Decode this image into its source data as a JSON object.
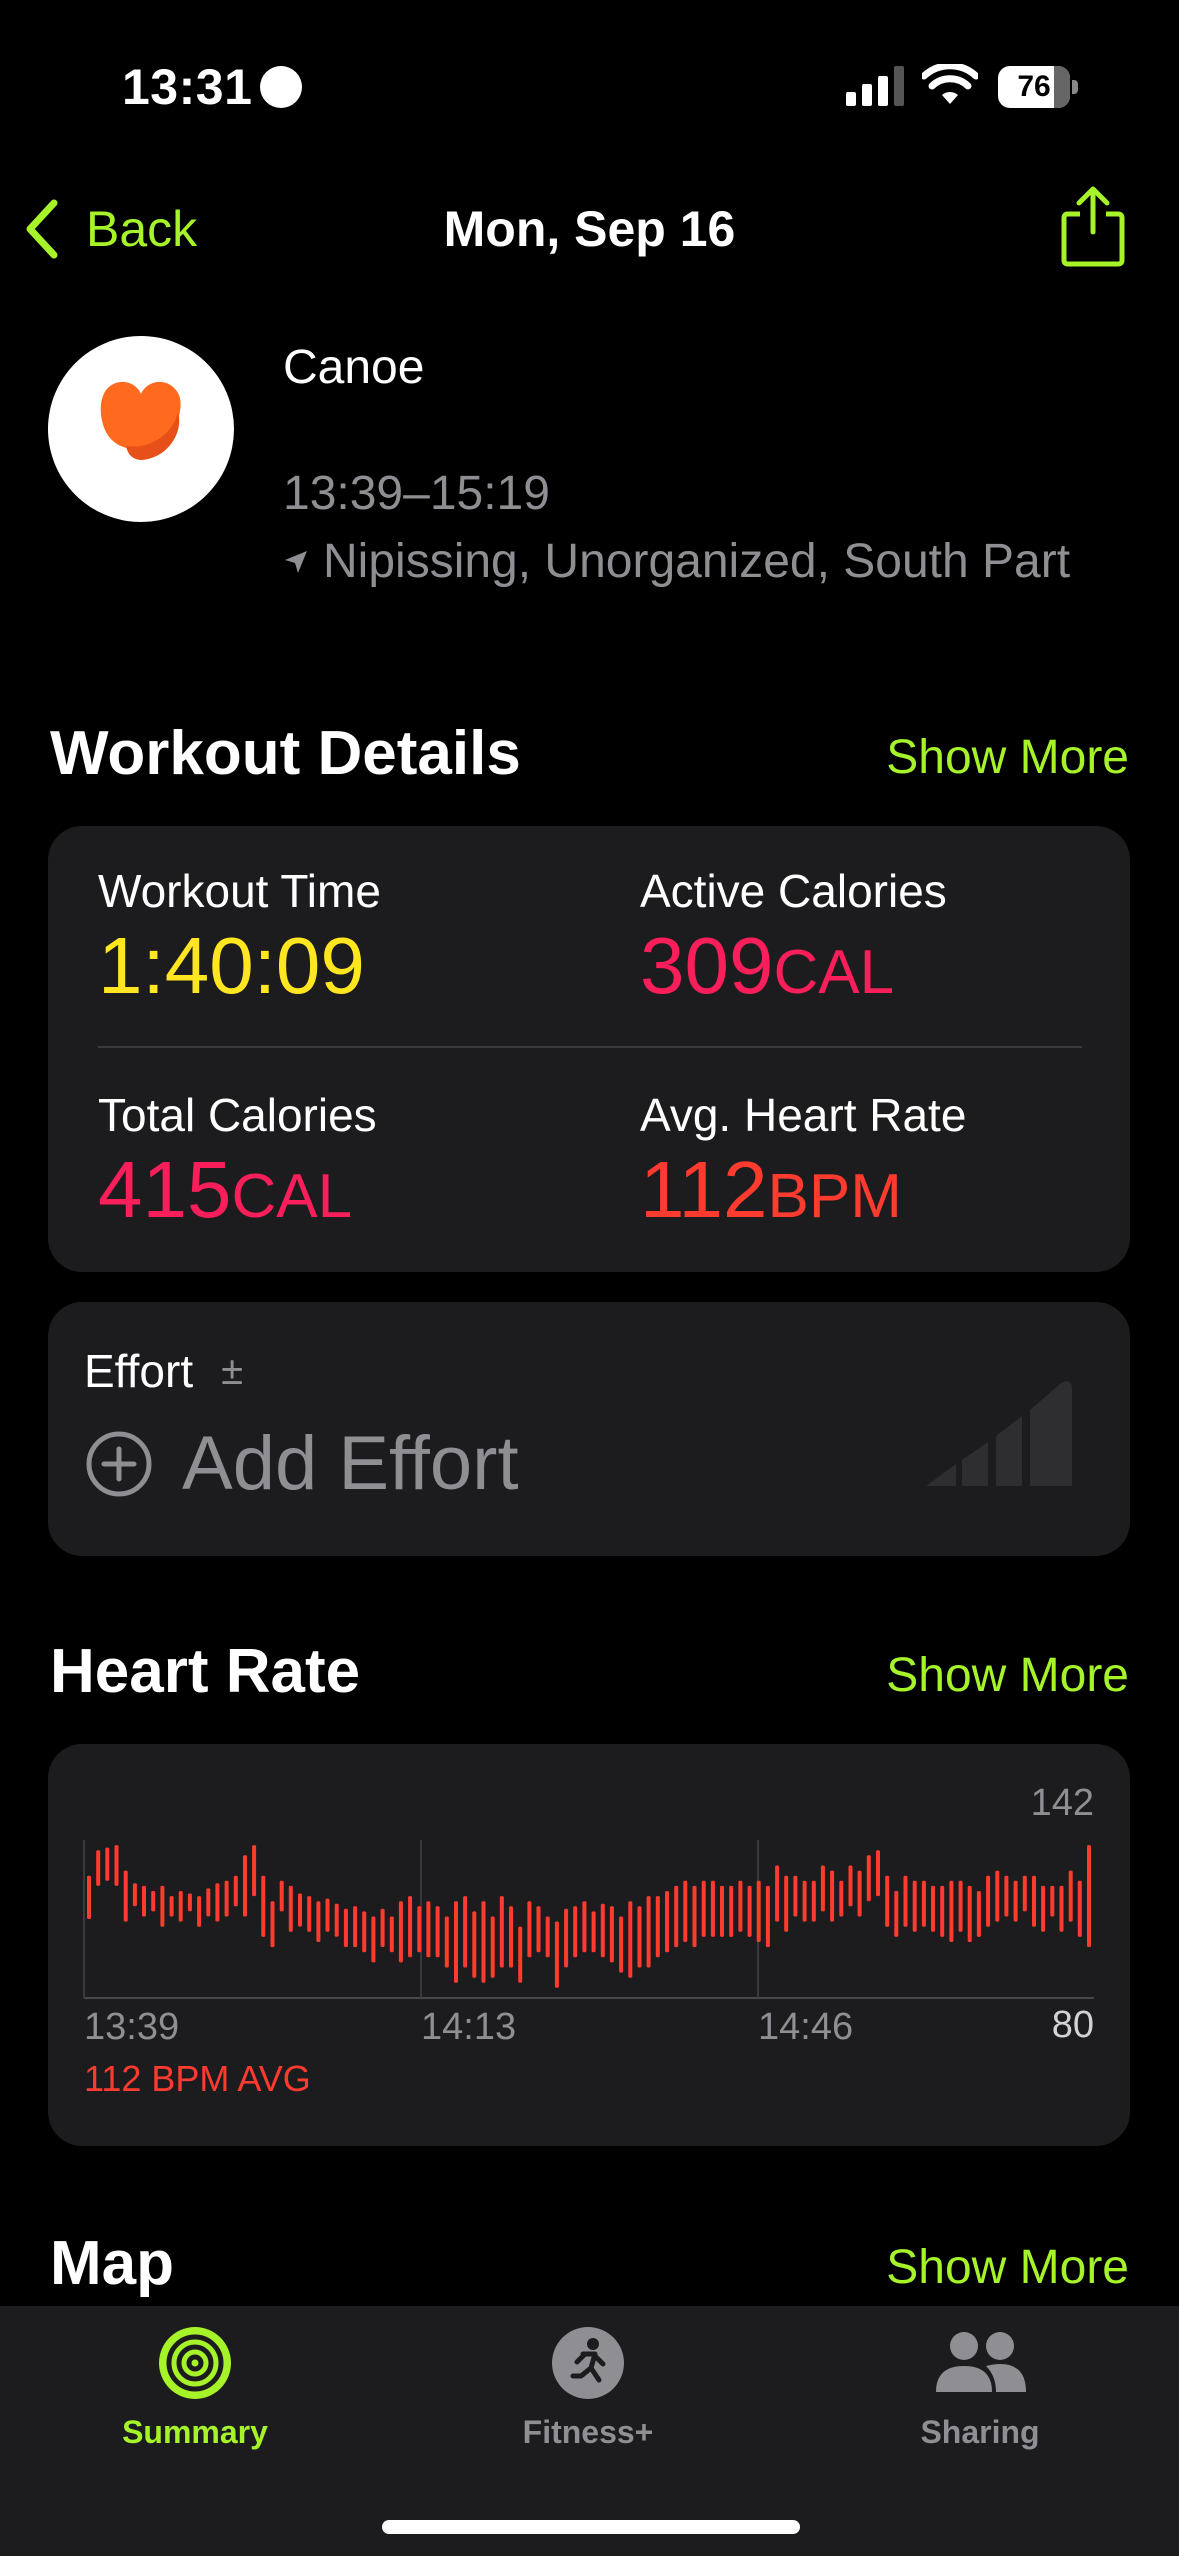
{
  "status_bar": {
    "time": "13:31",
    "battery": "76"
  },
  "nav": {
    "back_label": "Back",
    "title": "Mon, Sep 16"
  },
  "activity": {
    "name": "Canoe",
    "time_range": "13:39–15:19",
    "location": "Nipissing, Unorganized, South Part"
  },
  "workout_details": {
    "title": "Workout Details",
    "show_more": "Show More",
    "stats": [
      {
        "label": "Workout Time",
        "value": "1:40:09",
        "unit": "",
        "color": "#ffe620"
      },
      {
        "label": "Active Calories",
        "value": "309",
        "unit": "CAL",
        "color": "#fa1e5a"
      },
      {
        "label": "Total Calories",
        "value": "415",
        "unit": "CAL",
        "color": "#fa1e5a"
      },
      {
        "label": "Avg. Heart Rate",
        "value": "112",
        "unit": "BPM",
        "color": "#ff3b30"
      }
    ]
  },
  "effort": {
    "label": "Effort",
    "adjust_symbol": "±",
    "add_label": "Add Effort"
  },
  "heart_rate": {
    "title": "Heart Rate",
    "show_more": "Show More",
    "avg_label": "112 BPM AVG",
    "ymax_label": "142",
    "ymin_label": "80",
    "x_labels": [
      "13:39",
      "14:13",
      "14:46"
    ]
  },
  "chart_data": {
    "type": "bar",
    "title": "",
    "xlabel": "",
    "ylabel": "",
    "ylim": [
      80,
      142
    ],
    "x_ticks": [
      "13:39",
      "14:13",
      "14:46"
    ],
    "series": [
      {
        "values": [
          [
            111,
            128
          ],
          [
            124,
            138
          ],
          [
            126,
            139
          ],
          [
            124,
            140
          ],
          [
            110,
            130
          ],
          [
            116,
            125
          ],
          [
            112,
            124
          ],
          [
            114,
            122
          ],
          [
            108,
            124
          ],
          [
            112,
            120
          ],
          [
            110,
            122
          ],
          [
            114,
            121
          ],
          [
            108,
            120
          ],
          [
            112,
            123
          ],
          [
            110,
            125
          ],
          [
            112,
            126
          ],
          [
            116,
            128
          ],
          [
            112,
            136
          ],
          [
            120,
            140
          ],
          [
            104,
            128
          ],
          [
            100,
            118
          ],
          [
            114,
            126
          ],
          [
            106,
            124
          ],
          [
            108,
            121
          ],
          [
            106,
            120
          ],
          [
            102,
            118
          ],
          [
            106,
            119
          ],
          [
            104,
            117
          ],
          [
            100,
            115
          ],
          [
            100,
            116
          ],
          [
            98,
            114
          ],
          [
            94,
            112
          ],
          [
            100,
            115
          ],
          [
            98,
            112
          ],
          [
            94,
            118
          ],
          [
            96,
            120
          ],
          [
            98,
            116
          ],
          [
            96,
            118
          ],
          [
            96,
            116
          ],
          [
            92,
            112
          ],
          [
            86,
            118
          ],
          [
            92,
            120
          ],
          [
            88,
            114
          ],
          [
            86,
            118
          ],
          [
            88,
            112
          ],
          [
            92,
            120
          ],
          [
            92,
            116
          ],
          [
            86,
            108
          ],
          [
            96,
            118
          ],
          [
            98,
            116
          ],
          [
            96,
            112
          ],
          [
            84,
            110
          ],
          [
            92,
            115
          ],
          [
            96,
            116
          ],
          [
            98,
            118
          ],
          [
            98,
            114
          ],
          [
            96,
            117
          ],
          [
            94,
            116
          ],
          [
            90,
            112
          ],
          [
            88,
            118
          ],
          [
            92,
            116
          ],
          [
            92,
            120
          ],
          [
            96,
            120
          ],
          [
            98,
            122
          ],
          [
            100,
            124
          ],
          [
            102,
            126
          ],
          [
            100,
            124
          ],
          [
            104,
            126
          ],
          [
            104,
            126
          ],
          [
            104,
            124
          ],
          [
            104,
            124
          ],
          [
            106,
            126
          ],
          [
            104,
            124
          ],
          [
            102,
            126
          ],
          [
            100,
            124
          ],
          [
            110,
            132
          ],
          [
            106,
            128
          ],
          [
            112,
            128
          ],
          [
            110,
            126
          ],
          [
            110,
            126
          ],
          [
            114,
            132
          ],
          [
            110,
            130
          ],
          [
            112,
            126
          ],
          [
            116,
            132
          ],
          [
            112,
            130
          ],
          [
            118,
            136
          ],
          [
            120,
            138
          ],
          [
            108,
            128
          ],
          [
            104,
            122
          ],
          [
            108,
            128
          ],
          [
            106,
            126
          ],
          [
            108,
            126
          ],
          [
            106,
            124
          ],
          [
            104,
            124
          ],
          [
            102,
            126
          ],
          [
            106,
            126
          ],
          [
            102,
            124
          ],
          [
            104,
            122
          ],
          [
            108,
            128
          ],
          [
            110,
            130
          ],
          [
            112,
            128
          ],
          [
            110,
            126
          ],
          [
            114,
            128
          ],
          [
            108,
            128
          ],
          [
            106,
            124
          ],
          [
            112,
            124
          ],
          [
            106,
            124
          ],
          [
            110,
            130
          ],
          [
            104,
            126
          ],
          [
            100,
            140
          ]
        ]
      }
    ],
    "grid": true
  },
  "map": {
    "title": "Map",
    "show_more": "Show More"
  },
  "tabs": [
    {
      "label": "Summary",
      "active": true
    },
    {
      "label": "Fitness+",
      "active": false
    },
    {
      "label": "Sharing",
      "active": false
    }
  ],
  "colors": {
    "accent": "#a6f32a",
    "heart": "#ff3b30",
    "calorie": "#fa1e5a",
    "time": "#ffe620",
    "card": "#1c1c1e"
  }
}
